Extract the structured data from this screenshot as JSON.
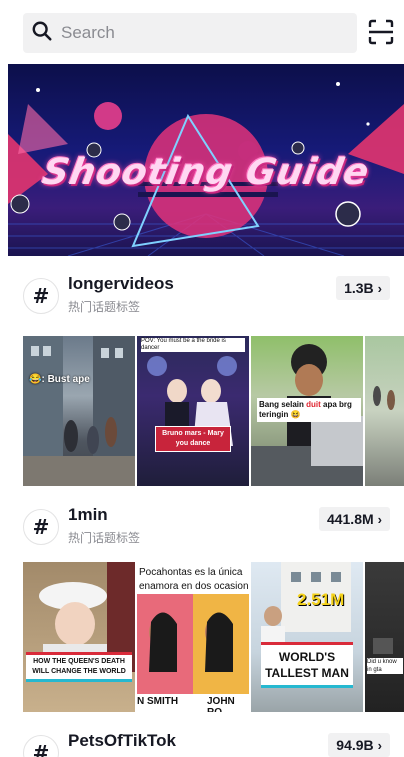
{
  "search": {
    "placeholder": "Search"
  },
  "banner": {
    "title": "Shooting Guide"
  },
  "hashtags": [
    {
      "name": "longervideos",
      "subtitle": "热门话题标签",
      "count": "1.3B"
    },
    {
      "name": "1min",
      "subtitle": "热门话题标签",
      "count": "441.8M"
    },
    {
      "name": "PetsOfTikTok",
      "count": "94.9B"
    }
  ],
  "thumbs1": {
    "t1_caption": "Bust ape",
    "t2_caption_top": "POV: You must be a the bride is dancer",
    "t2_caption": "Bruno mars - Mary you dance",
    "t3_caption": "Bang selain duit apa brg teringin",
    "t3_highlight": "duit"
  },
  "thumbs2": {
    "t1_caption": "HOW THE QUEEN'S DEATH WILL CHANGE THE WORLD",
    "t2_caption_top": "Pocahontas es la única",
    "t2_caption_mid": "enamora en dos ocasion",
    "t2_label_left": "N SMITH",
    "t2_label_right": "JOHN RO",
    "t3_number": "2.51M",
    "t3_caption": "WORLD'S TALLEST MAN",
    "t4_caption": "Did u know in gta"
  },
  "colors": {
    "accent": "#161823",
    "muted": "#8a8b91",
    "chip": "#f1f1f2"
  }
}
